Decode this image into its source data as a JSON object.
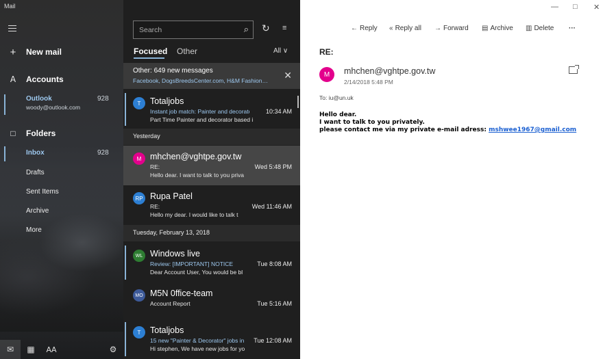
{
  "app": {
    "title": "Mail"
  },
  "sidebar": {
    "new_mail": "New mail",
    "accounts_label": "Accounts",
    "account": {
      "name": "Outlook",
      "email": "woody@outlook.com",
      "count": "928"
    },
    "folders_label": "Folders",
    "folders": [
      {
        "name": "Inbox",
        "count": "928",
        "selected": true
      },
      {
        "name": "Drafts",
        "count": ""
      },
      {
        "name": "Sent Items",
        "count": ""
      },
      {
        "name": "Archive",
        "count": ""
      },
      {
        "name": "More",
        "count": ""
      }
    ],
    "bottom_icons": [
      "mail-icon",
      "calendar-icon",
      "people-icon",
      "settings-icon"
    ]
  },
  "list": {
    "search_placeholder": "Search",
    "tab_focused": "Focused",
    "tab_other": "Other",
    "filter": "All",
    "other_banner": {
      "title": "Other: 649 new messages",
      "senders": "Facebook, DogsBreedsCenter.com, H&M Fashion…"
    },
    "groups": [
      {
        "header": "",
        "messages": [
          {
            "initials": "T",
            "color": "#2d7fd3",
            "from": "Totaljobs",
            "subject": "Instant job match: Painter and decorator",
            "time": "10:34 AM",
            "preview": "Part Time  Painter and decorator  based i",
            "unread": true
          }
        ]
      },
      {
        "header": "Yesterday",
        "messages": [
          {
            "initials": "M",
            "color": "#e3008c",
            "from": "mhchen@vghtpe.gov.tw",
            "subject": "RE:",
            "time": "Wed 5:48 PM",
            "preview": "Hello dear.  I want to talk to you priva",
            "selected": true
          },
          {
            "initials": "RP",
            "color": "#2d7fd3",
            "from": "Rupa Patel",
            "subject": "RE:",
            "time": "Wed 11:46 AM",
            "preview": "Hello my dear.  I would like to talk t"
          }
        ]
      },
      {
        "header": "Tuesday, February 13, 2018",
        "messages": [
          {
            "initials": "WL",
            "color": "#2e7d32",
            "from": "Windows live",
            "subject": "Review: [IMPORTANT] NOTICE",
            "time": "Tue 8:08 AM",
            "preview": "Dear Account User,   You would be bl",
            "unread": true
          },
          {
            "initials": "MO",
            "color": "#3d5a99",
            "from": "M5N 0ffice-team",
            "subject": "Account Report",
            "time": "Tue 5:16 AM",
            "preview": ""
          },
          {
            "initials": "T",
            "color": "#2d7fd3",
            "from": "Totaljobs",
            "subject": "15 new \"Painter & Decorator\" jobs in",
            "time": "Tue 12:08 AM",
            "preview": "Hi stephen, We have new jobs for yo",
            "unread": true
          }
        ]
      }
    ]
  },
  "reader": {
    "toolbar": {
      "reply": "Reply",
      "reply_all": "Reply all",
      "forward": "Forward",
      "archive": "Archive",
      "delete": "Delete",
      "more": "···"
    },
    "subject": "RE:",
    "sender": {
      "initial": "M",
      "name": "mhchen@vghtpe.gov.tw",
      "date": "2/14/2018 5:48 PM"
    },
    "to": "To: iu@un.uk",
    "body": {
      "line1": "Hello dear.",
      "line2": "I want to talk to you privately.",
      "line3_prefix": "please contact me via my private e-mail adress: ",
      "link": "mshwee1967@gmail.com"
    }
  }
}
